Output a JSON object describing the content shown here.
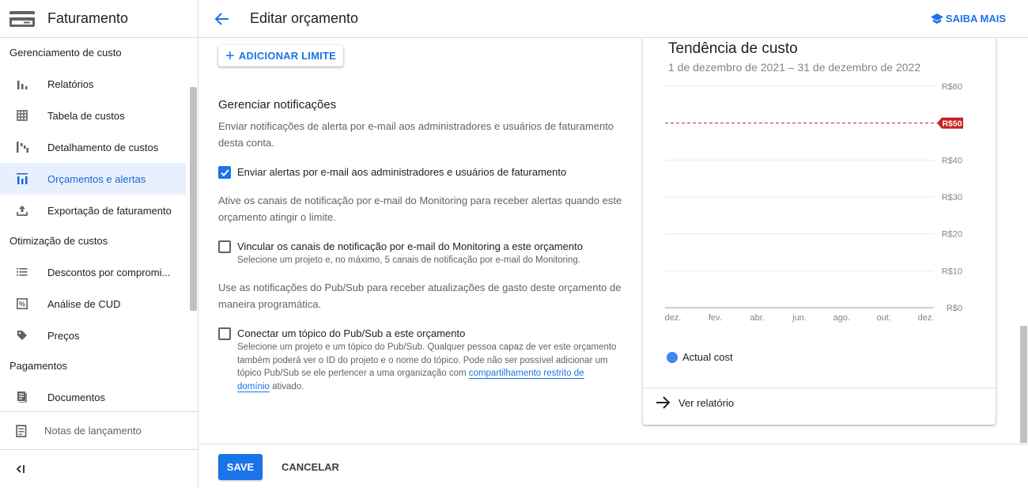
{
  "sidebar": {
    "title": "Faturamento",
    "sections": [
      {
        "label": "Gerenciamento de custo",
        "items": [
          {
            "label": "Relatórios",
            "icon": "bar-chart-icon"
          },
          {
            "label": "Tabela de custos",
            "icon": "table-icon"
          },
          {
            "label": "Detalhamento de custos",
            "icon": "waterfall-chart-icon"
          },
          {
            "label": "Orçamentos e alertas",
            "icon": "budget-icon",
            "active": true
          },
          {
            "label": "Exportação de faturamento",
            "icon": "export-icon"
          }
        ]
      },
      {
        "label": "Otimização de custos",
        "items": [
          {
            "label": "Descontos por compromi...",
            "icon": "list-icon"
          },
          {
            "label": "Análise de CUD",
            "icon": "percent-icon"
          },
          {
            "label": "Preços",
            "icon": "tag-icon"
          }
        ]
      },
      {
        "label": "Pagamentos",
        "items": [
          {
            "label": "Documentos",
            "icon": "document-icon"
          }
        ]
      }
    ],
    "release_notes": "Notas de lançamento"
  },
  "header": {
    "title": "Editar orçamento",
    "learn_more": "SAIBA MAIS"
  },
  "main": {
    "add_limit": "ADICIONAR LIMITE",
    "notifications_title": "Gerenciar notificações",
    "notifications_desc": "Enviar notificações de alerta por e-mail aos administradores e usuários de faturamento desta conta.",
    "email_alerts_label": "Enviar alertas por e-mail aos administradores e usuários de faturamento",
    "email_alerts_checked": true,
    "monitoring_desc": "Ative os canais de notificação por e-mail do Monitoring para receber alertas quando este orçamento atingir o limite.",
    "monitoring_label": "Vincular os canais de notificação por e-mail do Monitoring a este orçamento",
    "monitoring_sub": "Selecione um projeto e, no máximo, 5 canais de notificação por e-mail do Monitoring.",
    "monitoring_checked": false,
    "pubsub_desc": "Use as notificações do Pub/Sub para receber atualizações de gasto deste orçamento de maneira programática.",
    "pubsub_label": "Conectar um tópico do Pub/Sub a este orçamento",
    "pubsub_sub": "Selecione um projeto e um tópico do Pub/Sub. Qualquer pessoa capaz de ver este orçamento também poderá ver o ID do projeto e o nome do tópico. Pode não ser possível adicionar um tópico Pub/Sub se ele pertencer a uma organização com ",
    "pubsub_link": "compartilhamento restrito de domínio",
    "pubsub_sub_end": " ativado.",
    "pubsub_checked": false
  },
  "card": {
    "title": "Tendência de custo",
    "date_range": "1 de dezembro de 2021 – 31 de dezembro de 2022",
    "view_report": "Ver relatório"
  },
  "chart_data": {
    "type": "line",
    "title": "Tendência de custo",
    "categories": [
      "dez.",
      "fev.",
      "abr.",
      "jun.",
      "ago.",
      "out.",
      "dez."
    ],
    "y_ticks": [
      "R$0",
      "R$10",
      "R$20",
      "R$30",
      "R$40",
      "R$50",
      "R$60"
    ],
    "ylim": [
      0,
      60
    ],
    "budget_line": {
      "value": 50,
      "label": "R$50",
      "color": "#c5221f"
    },
    "series": [
      {
        "name": "Actual cost",
        "values": [],
        "color": "#4285f4"
      }
    ],
    "legend": "bottom-left",
    "grid": true
  },
  "footer": {
    "save": "SAVE",
    "cancel": "CANCELAR"
  },
  "colors": {
    "accent": "#1a73e8",
    "active_bg": "#e8f0fe",
    "budget_red": "#c5221f"
  }
}
